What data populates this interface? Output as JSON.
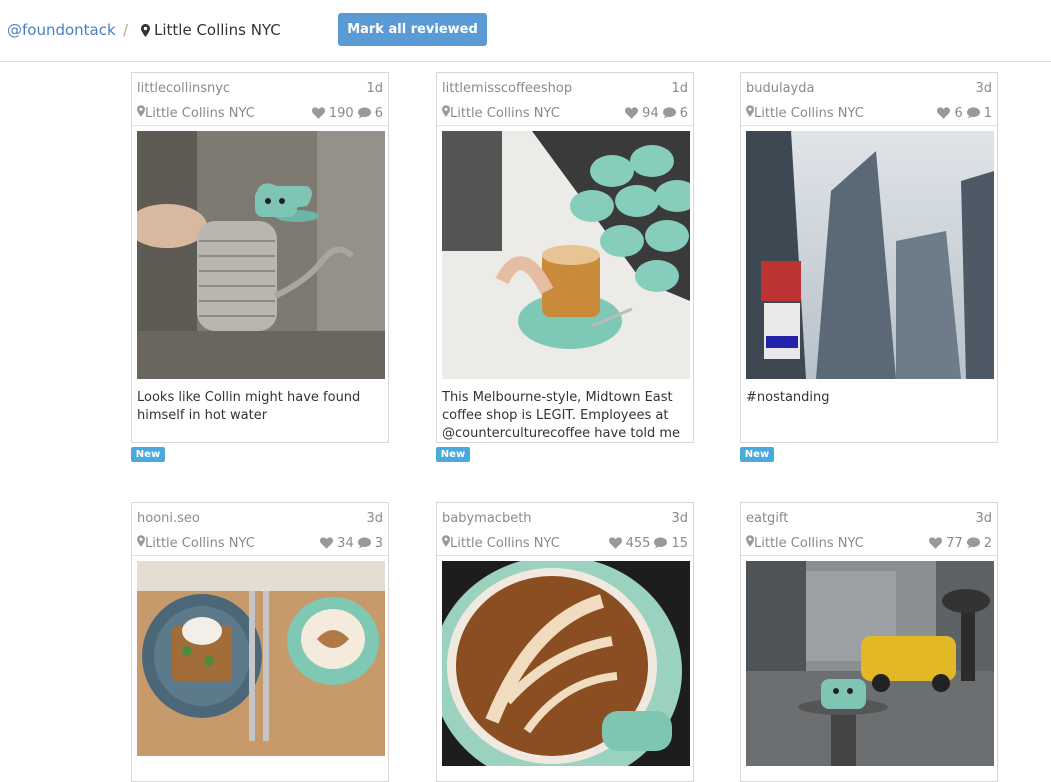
{
  "header": {
    "account": "@foundontack",
    "separator": "/",
    "location": "Little Collins NYC",
    "mark_all_label": "Mark all reviewed"
  },
  "posts": [
    {
      "user": "littlecollinsnyc",
      "age": "1d",
      "location": "Little Collins NYC",
      "likes": "190",
      "comments": "6",
      "caption": "Looks like Collin might have found himself in hot water",
      "badge": "New"
    },
    {
      "user": "littlemisscoffeeshop",
      "age": "1d",
      "location": "Little Collins NYC",
      "likes": "94",
      "comments": "6",
      "caption": "This Melbourne-style, Midtown East coffee shop is LEGIT. Employees at @counterculturecoffee have told me",
      "badge": "New"
    },
    {
      "user": "budulayda",
      "age": "3d",
      "location": "Little Collins NYC",
      "likes": "6",
      "comments": "1",
      "caption": "#nostanding",
      "badge": "New"
    },
    {
      "user": "hooni.seo",
      "age": "3d",
      "location": "Little Collins NYC",
      "likes": "34",
      "comments": "3",
      "caption": "",
      "badge": ""
    },
    {
      "user": "babymacbeth",
      "age": "3d",
      "location": "Little Collins NYC",
      "likes": "455",
      "comments": "15",
      "caption": "",
      "badge": ""
    },
    {
      "user": "eatgift",
      "age": "3d",
      "location": "Little Collins NYC",
      "likes": "77",
      "comments": "2",
      "caption": "",
      "badge": ""
    }
  ],
  "colors": {
    "link": "#4a7fc1",
    "button": "#5b9bd5",
    "badge": "#4aa9dd"
  }
}
